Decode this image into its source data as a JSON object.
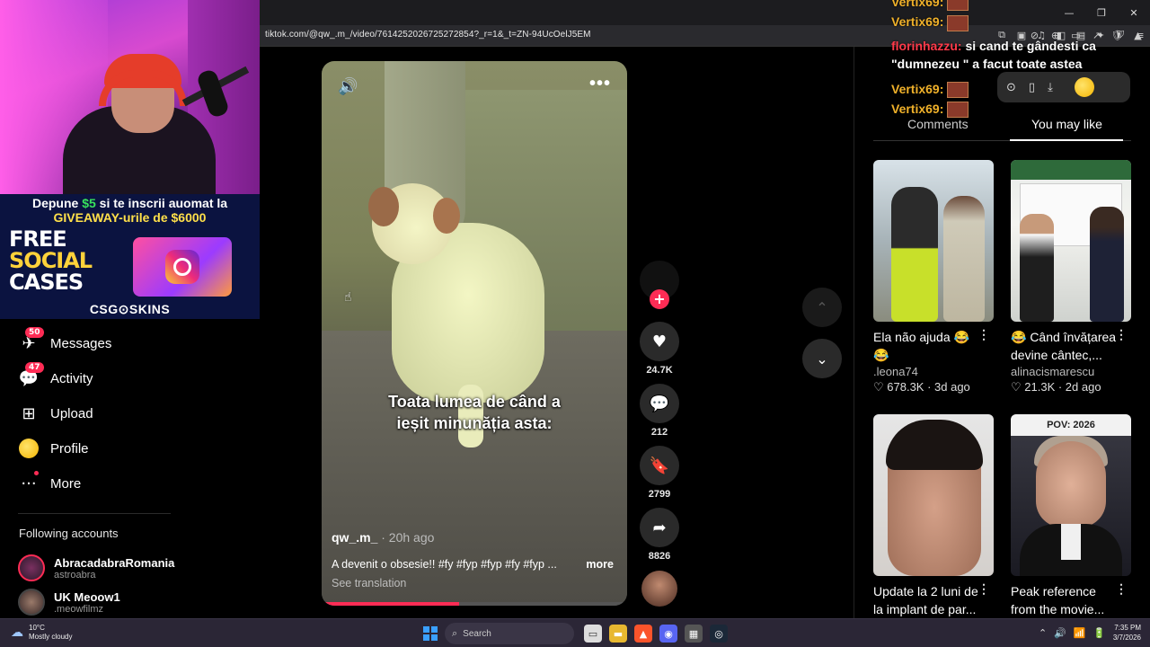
{
  "browser": {
    "url": "tiktok.com/@qw_.m_/video/7614252026725272854?_r=1&_t=ZN-94UcOelJ5EM",
    "window_controls": [
      "—",
      "❐",
      "✕"
    ],
    "addr_icons": [
      "⊘",
      "⊕",
      "▭",
      "↗",
      "🛡",
      "▲"
    ],
    "toolbar_icons": [
      "⧉",
      "▣",
      "♫",
      "◧",
      "▤",
      "✦",
      "⛉",
      "≡"
    ],
    "popup_icons": [
      "⊙",
      "▯",
      "⤓"
    ]
  },
  "promo": {
    "line1_pre": "Depune ",
    "line1_amount": "$5",
    "line1_post": " si te inscrii auomat la",
    "line2_pre": "GIVEAWAY-urile de ",
    "line2_amount": "$6000",
    "big_free": "FREE",
    "big_social": "SOCIAL",
    "big_cases": "CASES",
    "brand": "CSG⊙SKINS"
  },
  "nav": {
    "items": [
      {
        "label": "Messages",
        "icon": "✈",
        "badge": "50"
      },
      {
        "label": "Activity",
        "icon": "💬",
        "badge": "47"
      },
      {
        "label": "Upload",
        "icon": "⊞",
        "badge": ""
      },
      {
        "label": "Profile",
        "icon": "",
        "badge": ""
      },
      {
        "label": "More",
        "icon": "···",
        "badge": ""
      }
    ],
    "following_title": "Following accounts",
    "accounts": [
      {
        "name": "AbracadabraRomania",
        "handle": "astroabra"
      },
      {
        "name": "UK Meoow1",
        "handle": ".meowfilmz"
      }
    ]
  },
  "video": {
    "caption_line1": "Toata lumea de când a",
    "caption_line2": "ieșit minunăția asta:",
    "username": "qw_.m_",
    "time": " · 20h ago",
    "description": "A devenit o obsesie!! #fy #fyp #fyp #fy #fyp ...",
    "more_label": "more",
    "translation_label": "See translation",
    "progress": 0.45,
    "sound_icon": "🔊",
    "more_icon": "•••"
  },
  "actions": {
    "follow_icon": "+",
    "like_icon": "♥",
    "like_count": "24.7K",
    "comment_icon": "💬",
    "comment_count": "212",
    "save_icon": "🔖",
    "save_count": "2799",
    "share_icon": "➦",
    "share_count": "8826"
  },
  "feed_nav": {
    "up_icon": "⌃",
    "down_icon": "⌄"
  },
  "chat": [
    {
      "user": "Vertix69:",
      "text": "",
      "emote": true
    },
    {
      "user": "Vertix69:",
      "text": "",
      "emote": true
    },
    {
      "user": "florinhazzu:",
      "text": "si cand te gândesti ca \"dumnezeu \" a facut toate astea",
      "emote": false
    },
    {
      "user": "Vertix69:",
      "text": "",
      "emote": true
    },
    {
      "user": "Vertix69:",
      "text": "",
      "emote": true
    }
  ],
  "tabs": {
    "comments": "Comments",
    "you_may_like": "You may like"
  },
  "recommendations": [
    {
      "title": "Ela não ajuda 😂😂",
      "author": ".leona74",
      "stats": "♡ 678.3K · 3d ago"
    },
    {
      "title": "😂 Când învățarea devine cântec,...",
      "author": "alinacismarescu",
      "stats": "♡ 21.3K · 2d ago"
    },
    {
      "title": "Update la 2 luni de la implant de par...",
      "author": "",
      "stats": ""
    },
    {
      "title": "Peak reference from the movie...",
      "author": "",
      "stats": "",
      "banner": "POV: 2026"
    }
  ],
  "taskbar": {
    "temperature": "10°C",
    "weather": "Mostly cloudy",
    "search_placeholder": "Search",
    "time": "7:35 PM",
    "date": "3/7/2026",
    "tray_icons": [
      "⌃",
      "🔊",
      "📶",
      "🔋"
    ]
  },
  "colors": {
    "accent": "#fe2c55",
    "chat_user": "#f0b12a",
    "chat_user_alt": "#ff3a4a"
  }
}
